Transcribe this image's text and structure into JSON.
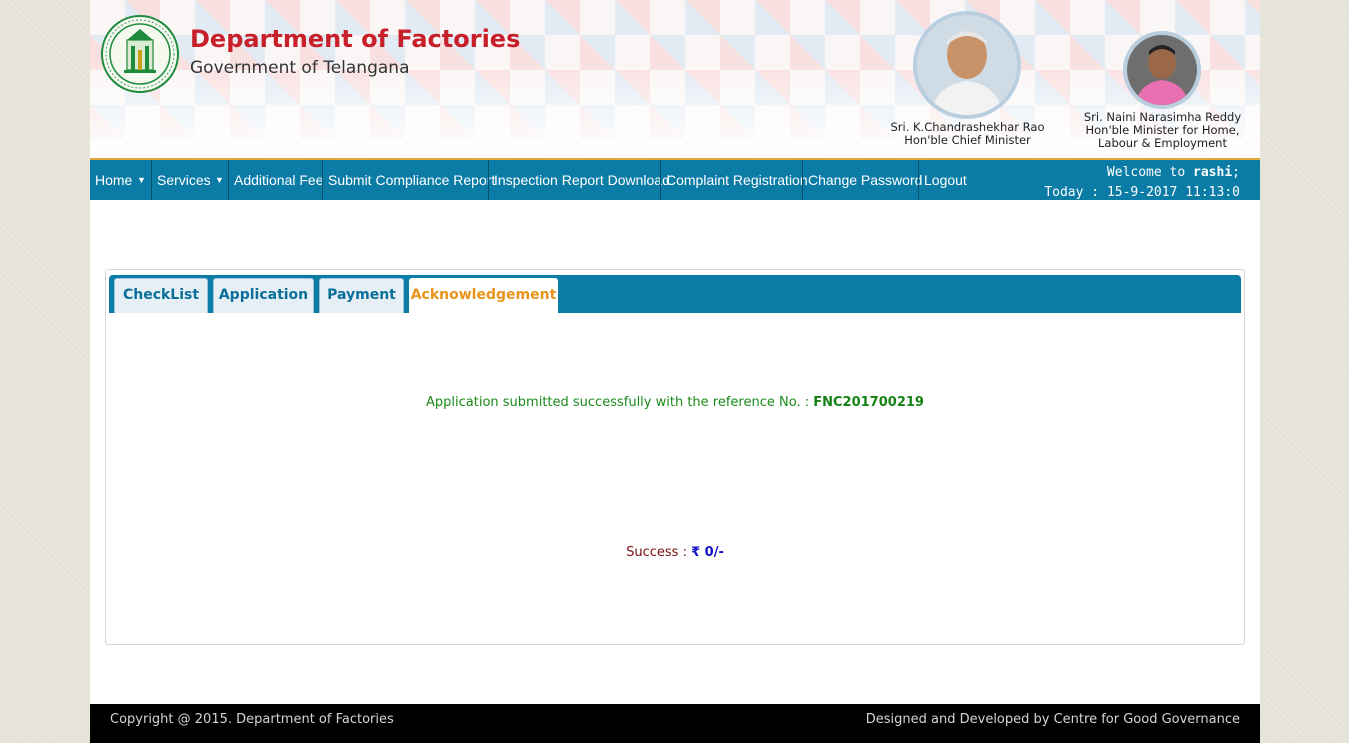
{
  "header": {
    "title": "Department of Factories",
    "subtitle": "Government of Telangana",
    "people": [
      {
        "name": "Sri. K.Chandrashekhar Rao",
        "role": "Hon'ble Chief Minister"
      },
      {
        "name": "Sri. Naini Narasimha Reddy",
        "role_line1": "Hon'ble Minister for Home,",
        "role_line2": "Labour & Employment"
      }
    ]
  },
  "nav": {
    "items": [
      "Home",
      "Services",
      "Additional Fee",
      "Submit Compliance Report",
      "Inspection Report Download",
      "Complaint Registration",
      "Change Password",
      "Logout"
    ],
    "welcome_prefix": "Welcome to",
    "username": "rashi",
    "welcome_suffix": ";",
    "today_label": "Today :",
    "today_value": "15-9-2017 11:13:0"
  },
  "tabs": [
    {
      "label": "CheckList",
      "active": false
    },
    {
      "label": "Application",
      "active": false
    },
    {
      "label": "Payment",
      "active": false
    },
    {
      "label": "Acknowledgement",
      "active": true
    }
  ],
  "acknowledgement": {
    "message": "Application submitted successfully with the reference No. :",
    "reference_no": "FNC201700219",
    "status_label": "Success :",
    "amount": "₹ 0/-"
  },
  "footer": {
    "copyright": "Copyright @ 2015. Department of Factories",
    "credit": "Designed and Developed by Centre for Good Governance"
  },
  "colors": {
    "nav_bg": "#0b7ca6",
    "accent_orange": "#e8931a",
    "title_red": "#c8202a",
    "success_green": "#1a8a1a"
  }
}
